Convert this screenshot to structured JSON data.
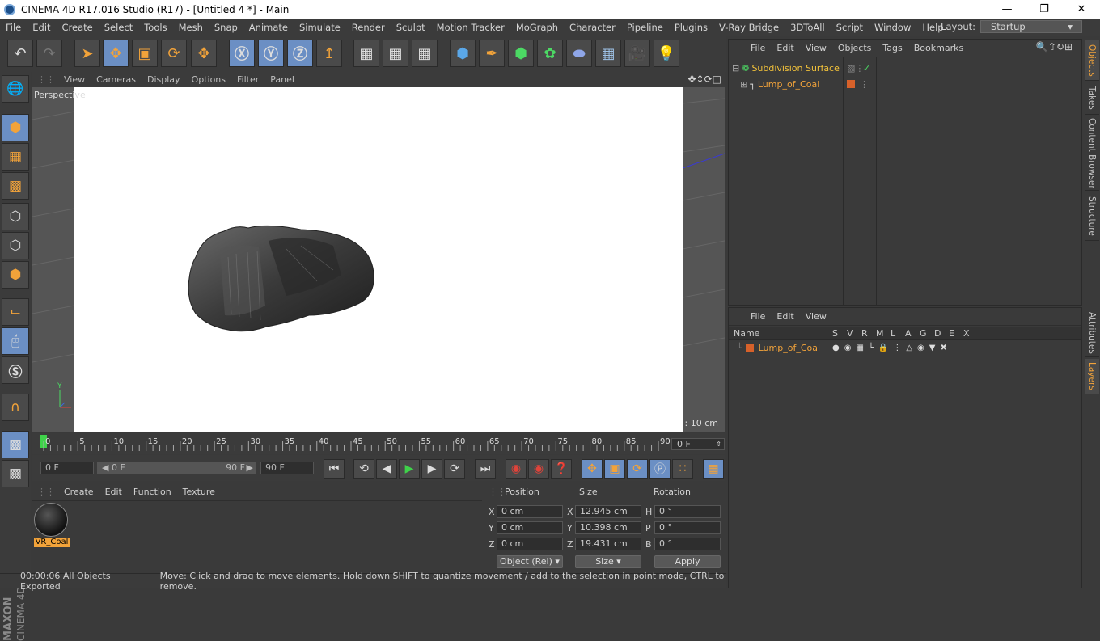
{
  "window": {
    "title": "CINEMA 4D R17.016 Studio (R17) - [Untitled 4 *] - Main"
  },
  "menu": [
    "File",
    "Edit",
    "Create",
    "Select",
    "Tools",
    "Mesh",
    "Snap",
    "Animate",
    "Simulate",
    "Render",
    "Sculpt",
    "Motion Tracker",
    "MoGraph",
    "Character",
    "Pipeline",
    "Plugins",
    "V-Ray Bridge",
    "3DToAll",
    "Script",
    "Window",
    "Help"
  ],
  "layout": {
    "label": "Layout:",
    "value": "Startup"
  },
  "viewport": {
    "menu": [
      "View",
      "Cameras",
      "Display",
      "Options",
      "Filter",
      "Panel"
    ],
    "camera_label": "Perspective",
    "grid_spacing": "Grid Spacing : 10 cm",
    "axis_y": "Y"
  },
  "timeline": {
    "ticks": [
      "0",
      "5",
      "10",
      "15",
      "20",
      "25",
      "30",
      "35",
      "40",
      "45",
      "50",
      "55",
      "60",
      "65",
      "70",
      "75",
      "80",
      "85",
      "90"
    ],
    "current_frame": "0 F"
  },
  "transport": {
    "start": "0 F",
    "range_start": "0 F",
    "range_end": "90 F",
    "end": "90 F"
  },
  "material_panel": {
    "menu": [
      "Create",
      "Edit",
      "Function",
      "Texture"
    ],
    "material_name": "VR_Coal"
  },
  "coordinates": {
    "headers": [
      "Position",
      "Size",
      "Rotation"
    ],
    "position": [
      {
        "axis": "X",
        "value": "0 cm"
      },
      {
        "axis": "Y",
        "value": "0 cm"
      },
      {
        "axis": "Z",
        "value": "0 cm"
      }
    ],
    "size": [
      {
        "axis": "X",
        "value": "12.945 cm"
      },
      {
        "axis": "Y",
        "value": "10.398 cm"
      },
      {
        "axis": "Z",
        "value": "19.431 cm"
      }
    ],
    "rotation": [
      {
        "axis": "H",
        "value": "0 °"
      },
      {
        "axis": "P",
        "value": "0 °"
      },
      {
        "axis": "B",
        "value": "0 °"
      }
    ],
    "mode": "Object (Rel)",
    "size_mode": "Size",
    "apply": "Apply"
  },
  "status": {
    "time": "00:00:06 All Objects Exported",
    "message": "Move: Click and drag to move elements. Hold down SHIFT to quantize movement / add to the selection in point mode, CTRL to remove."
  },
  "objects_panel": {
    "menu": [
      "File",
      "Edit",
      "View",
      "Objects",
      "Tags",
      "Bookmarks"
    ],
    "items": [
      {
        "name": "Subdivision Surface"
      },
      {
        "name": "Lump_of_Coal"
      }
    ],
    "check": "✓"
  },
  "layers_panel": {
    "menu": [
      "File",
      "Edit",
      "View"
    ],
    "columns": [
      "Name",
      "S",
      "V",
      "R",
      "M",
      "L",
      "A",
      "G",
      "D",
      "E",
      "X"
    ],
    "layer_name": "Lump_of_Coal",
    "layer_color": "#d7612a"
  },
  "right_tabs": {
    "objects": "Objects",
    "takes": "Takes",
    "content_browser": "Content Browser",
    "structure": "Structure",
    "attributes": "Attributes",
    "layers": "Layers"
  },
  "branding": {
    "line1": "MAXON",
    "line2": "CINEMA 4D"
  },
  "colors": {
    "accent": "#f2a33a",
    "toolbar_active": "#6b8fc4"
  }
}
